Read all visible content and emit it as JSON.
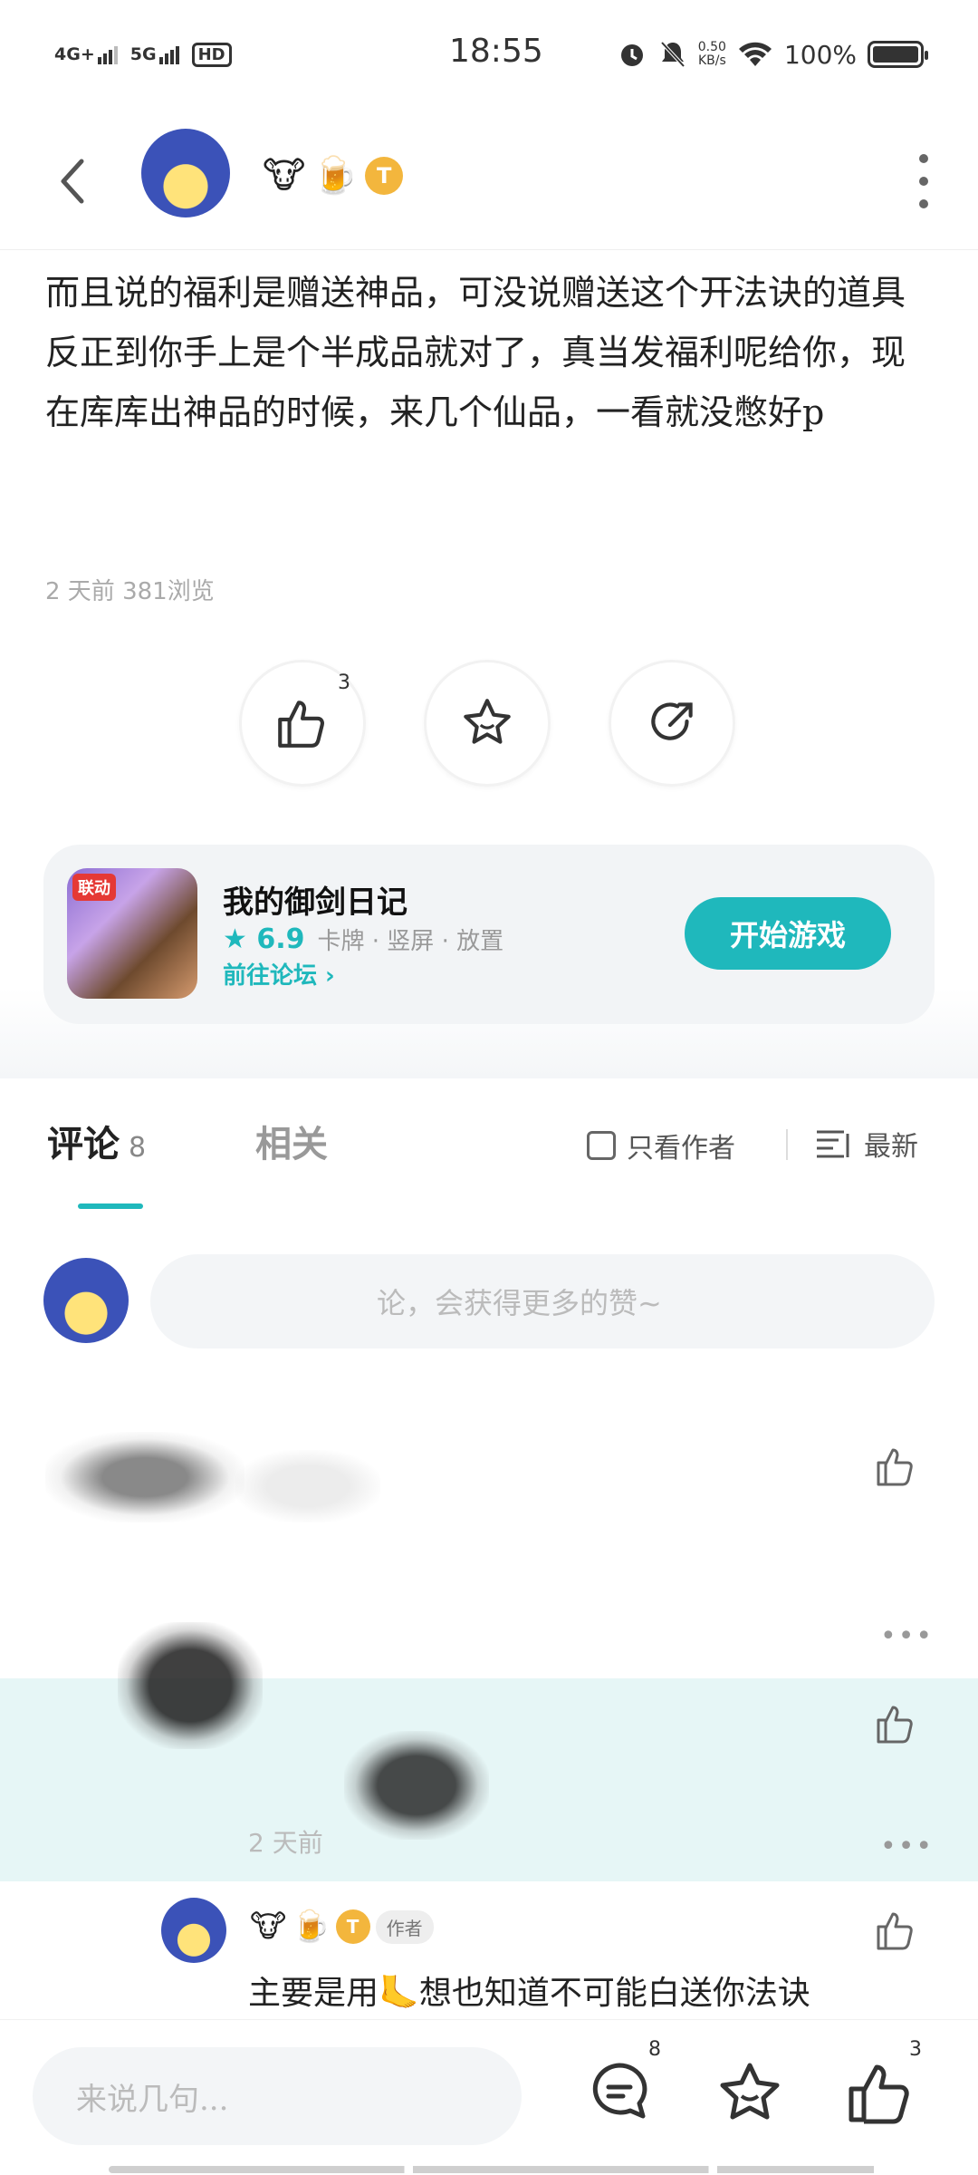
{
  "status_bar": {
    "network_1": "4G+",
    "network_2": "5G",
    "hd": "HD",
    "time": "18:55",
    "speed_value": "0.50",
    "speed_unit": "KB/s",
    "battery": "100%"
  },
  "post": {
    "paragraph_1": "而且说的福利是赠送神品，可没说赠送这个开法诀的道具",
    "paragraph_2": "反正到你手上是个半成品就对了，真当发福利呢给你，现在库库出神品的时候，来几个仙品，一看就没憋好p",
    "meta": "2 天前  381浏览",
    "like_count": "3"
  },
  "author_badges": [
    "🐮",
    "🍺"
  ],
  "badge_t": "T",
  "game_card": {
    "icon_tag": "联动",
    "title": "我的御剑日记",
    "score": "6.9",
    "tags": "卡牌 · 竖屏 · 放置",
    "forum_link": "前往论坛 ›",
    "start_button": "开始游戏"
  },
  "tabs": {
    "comments_label": "评论",
    "comments_count": "8",
    "related_label": "相关",
    "only_author": "只看作者",
    "sort": "最新"
  },
  "comment_input_placeholder": "论，会获得更多的赞~",
  "thread": {
    "time": "2 天前",
    "reply_author_tag": "作者",
    "reply_text": "主要是用🦶想也知道不可能白送你法诀"
  },
  "bottom_bar": {
    "input_placeholder": "来说几句...",
    "comment_count": "8",
    "like_count": "3"
  },
  "colors": {
    "accent": "#1fb8bc",
    "highlight": "#e6f6f6"
  }
}
